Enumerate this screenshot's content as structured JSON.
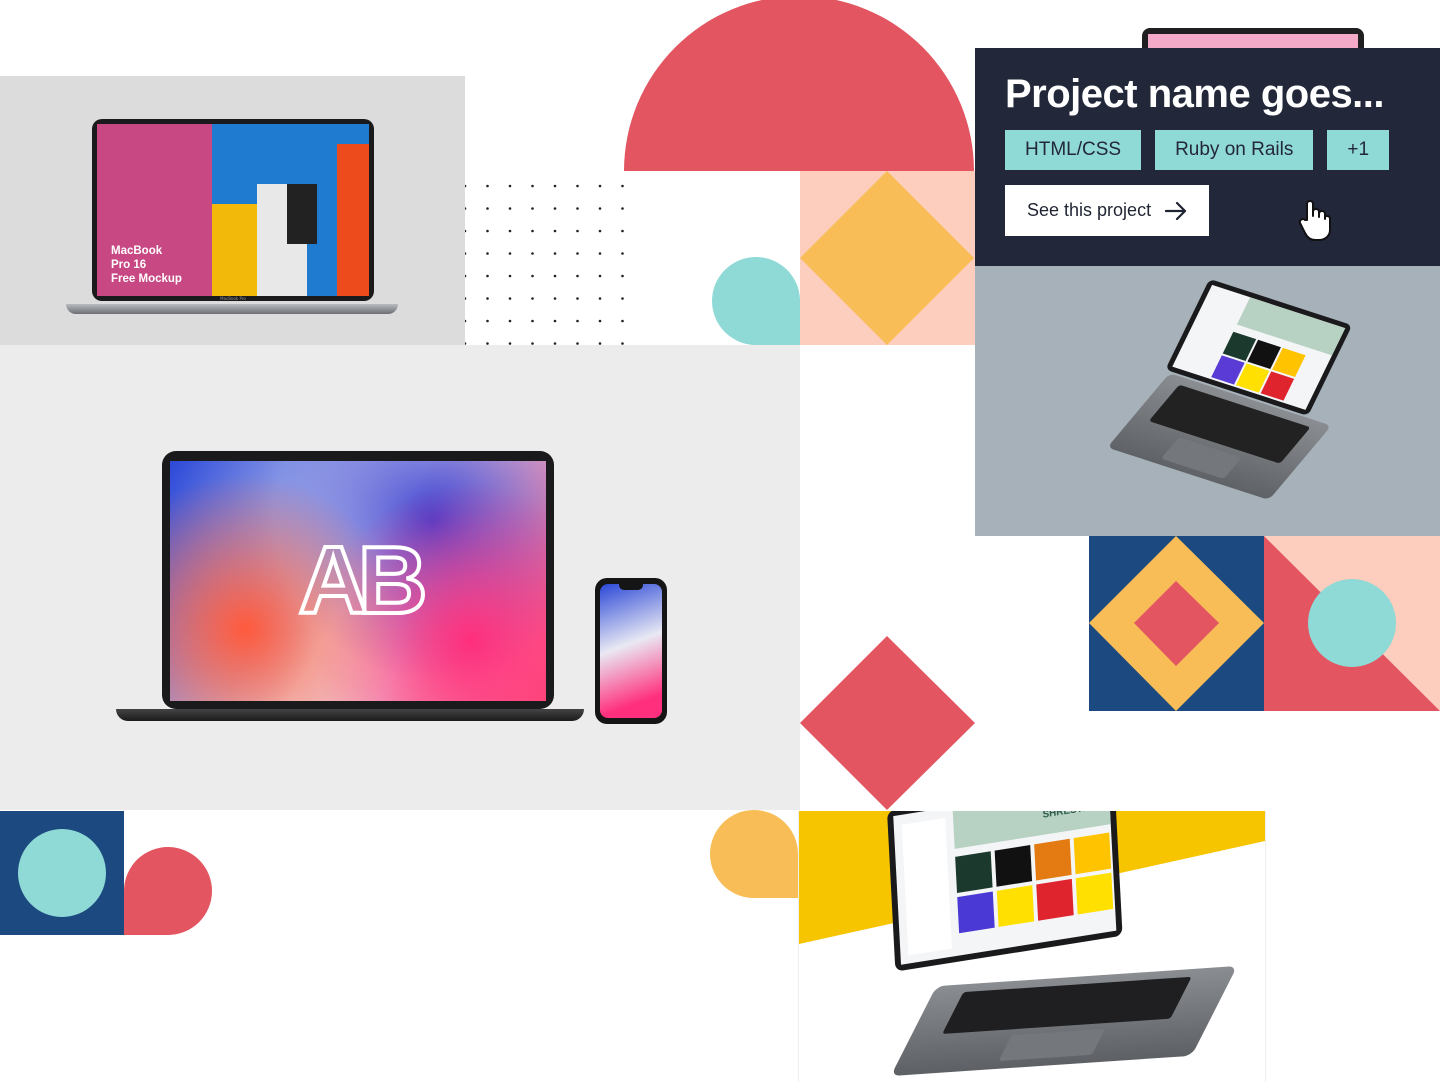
{
  "project_card": {
    "title": "Project name goes...",
    "tags": [
      "HTML/CSS",
      "Ruby on Rails",
      "+1"
    ],
    "cta_label": "See this project",
    "cta_icon": "arrow-right-icon",
    "cursor_icon": "hand-pointer-icon"
  },
  "mockups": {
    "macbook_pro_16": {
      "screen_text": "MacBook\nPro 16\nFree Mockup",
      "bezel_label": "MacBook Pro"
    },
    "anthony_boyd": {
      "logo_text": "AB"
    },
    "portfolio_laptop": {
      "screen_name": "SAGAR\nSHRESTHA"
    }
  },
  "colors": {
    "navy": "#1c4a80",
    "red": "#e25561",
    "yellow": "#f9bd57",
    "peach": "#fdcdbe",
    "teal": "#8fd9d6",
    "dark_panel": "#222739",
    "bright_yellow": "#f6c500"
  }
}
